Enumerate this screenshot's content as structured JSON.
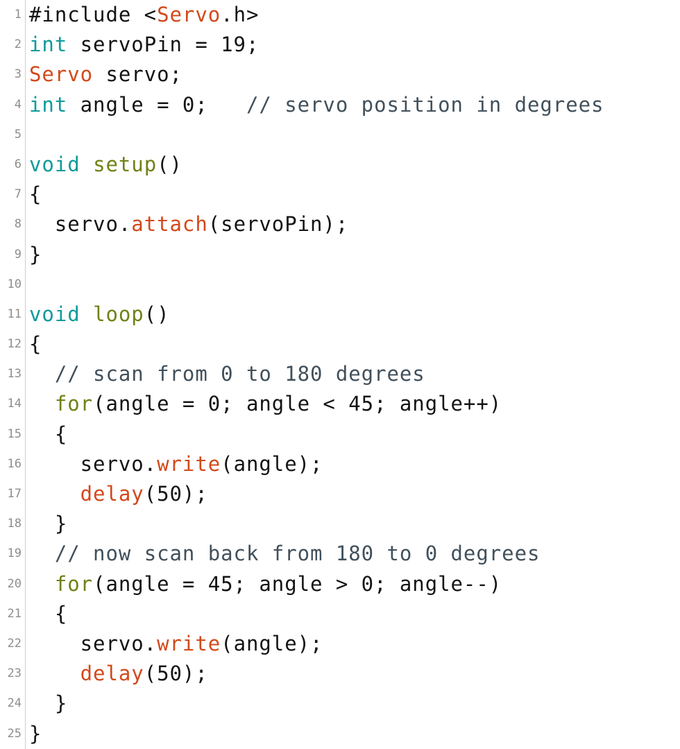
{
  "editor": {
    "language": "arduino-cpp",
    "total_lines": 25,
    "background": "#ffffff",
    "gutter_rule_color": "#cfcfcf",
    "line_number_color": "#8d8d8d",
    "colors": {
      "plain": "#141414",
      "keyword": "#0e9a9a",
      "type": "#d2491b",
      "function": "#6f8215",
      "call": "#d2491b",
      "comment": "#41505b"
    }
  },
  "lines": [
    {
      "number": "1",
      "text": "#include <Servo.h>",
      "tokens": [
        {
          "t": "#include <",
          "c": "plain"
        },
        {
          "t": "Servo",
          "c": "type"
        },
        {
          "t": ".h>",
          "c": "plain"
        }
      ]
    },
    {
      "number": "2",
      "text": "int servoPin = 19;",
      "tokens": [
        {
          "t": "int",
          "c": "keyword"
        },
        {
          "t": " servoPin = 19;",
          "c": "plain"
        }
      ]
    },
    {
      "number": "3",
      "text": "Servo servo;",
      "tokens": [
        {
          "t": "Servo",
          "c": "type"
        },
        {
          "t": " servo;",
          "c": "plain"
        }
      ]
    },
    {
      "number": "4",
      "text": "int angle = 0;   // servo position in degrees",
      "tokens": [
        {
          "t": "int",
          "c": "keyword"
        },
        {
          "t": " angle = 0;   ",
          "c": "plain"
        },
        {
          "t": "// servo position in degrees",
          "c": "comment"
        }
      ]
    },
    {
      "number": "5",
      "text": "",
      "tokens": []
    },
    {
      "number": "6",
      "text": "void setup()",
      "tokens": [
        {
          "t": "void",
          "c": "keyword"
        },
        {
          "t": " ",
          "c": "plain"
        },
        {
          "t": "setup",
          "c": "function"
        },
        {
          "t": "()",
          "c": "plain"
        }
      ]
    },
    {
      "number": "7",
      "text": "{",
      "tokens": [
        {
          "t": "{",
          "c": "plain"
        }
      ]
    },
    {
      "number": "8",
      "text": "  servo.attach(servoPin);",
      "tokens": [
        {
          "t": "  servo.",
          "c": "plain"
        },
        {
          "t": "attach",
          "c": "call"
        },
        {
          "t": "(servoPin);",
          "c": "plain"
        }
      ]
    },
    {
      "number": "9",
      "text": "}",
      "tokens": [
        {
          "t": "}",
          "c": "plain"
        }
      ]
    },
    {
      "number": "10",
      "text": "",
      "tokens": []
    },
    {
      "number": "11",
      "text": "void loop()",
      "tokens": [
        {
          "t": "void",
          "c": "keyword"
        },
        {
          "t": " ",
          "c": "plain"
        },
        {
          "t": "loop",
          "c": "function"
        },
        {
          "t": "()",
          "c": "plain"
        }
      ]
    },
    {
      "number": "12",
      "text": "{",
      "tokens": [
        {
          "t": "{",
          "c": "plain"
        }
      ]
    },
    {
      "number": "13",
      "text": "  // scan from 0 to 180 degrees",
      "tokens": [
        {
          "t": "  ",
          "c": "plain"
        },
        {
          "t": "// scan from 0 to 180 degrees",
          "c": "comment"
        }
      ]
    },
    {
      "number": "14",
      "text": "  for(angle = 0; angle < 45; angle++)",
      "tokens": [
        {
          "t": "  ",
          "c": "plain"
        },
        {
          "t": "for",
          "c": "function"
        },
        {
          "t": "(angle = 0; angle < 45; angle++)",
          "c": "plain"
        }
      ]
    },
    {
      "number": "15",
      "text": "  {",
      "tokens": [
        {
          "t": "  {",
          "c": "plain"
        }
      ]
    },
    {
      "number": "16",
      "text": "    servo.write(angle);",
      "tokens": [
        {
          "t": "    servo.",
          "c": "plain"
        },
        {
          "t": "write",
          "c": "call"
        },
        {
          "t": "(angle);",
          "c": "plain"
        }
      ]
    },
    {
      "number": "17",
      "text": "    delay(50);",
      "tokens": [
        {
          "t": "    ",
          "c": "plain"
        },
        {
          "t": "delay",
          "c": "call"
        },
        {
          "t": "(50);",
          "c": "plain"
        }
      ]
    },
    {
      "number": "18",
      "text": "  }",
      "tokens": [
        {
          "t": "  }",
          "c": "plain"
        }
      ]
    },
    {
      "number": "19",
      "text": "  // now scan back from 180 to 0 degrees",
      "tokens": [
        {
          "t": "  ",
          "c": "plain"
        },
        {
          "t": "// now scan back from 180 to 0 degrees",
          "c": "comment"
        }
      ]
    },
    {
      "number": "20",
      "text": "  for(angle = 45; angle > 0; angle--)",
      "tokens": [
        {
          "t": "  ",
          "c": "plain"
        },
        {
          "t": "for",
          "c": "function"
        },
        {
          "t": "(angle = 45; angle > 0; angle--)",
          "c": "plain"
        }
      ]
    },
    {
      "number": "21",
      "text": "  {",
      "tokens": [
        {
          "t": "  {",
          "c": "plain"
        }
      ]
    },
    {
      "number": "22",
      "text": "    servo.write(angle);",
      "tokens": [
        {
          "t": "    servo.",
          "c": "plain"
        },
        {
          "t": "write",
          "c": "call"
        },
        {
          "t": "(angle);",
          "c": "plain"
        }
      ]
    },
    {
      "number": "23",
      "text": "    delay(50);",
      "tokens": [
        {
          "t": "    ",
          "c": "plain"
        },
        {
          "t": "delay",
          "c": "call"
        },
        {
          "t": "(50);",
          "c": "plain"
        }
      ]
    },
    {
      "number": "24",
      "text": "  }",
      "tokens": [
        {
          "t": "  }",
          "c": "plain"
        }
      ]
    },
    {
      "number": "25",
      "text": "}",
      "tokens": [
        {
          "t": "}",
          "c": "plain"
        }
      ]
    }
  ]
}
